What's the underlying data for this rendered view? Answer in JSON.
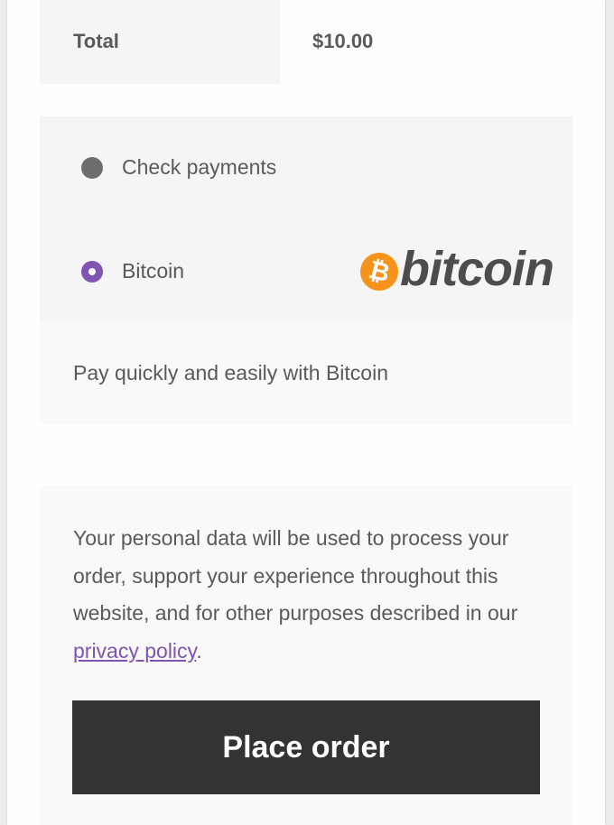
{
  "order_summary": {
    "total_label": "Total",
    "total_value": "$10.00"
  },
  "payment": {
    "methods": [
      {
        "label": "Check payments",
        "selected": false
      },
      {
        "label": "Bitcoin",
        "selected": true
      }
    ],
    "bitcoin_logo": {
      "symbol": "₿",
      "wordmark": "bitcoin"
    },
    "selected_description": "Pay quickly and easily with Bitcoin"
  },
  "privacy": {
    "text": "Your personal data will be used to process your order, support your experience throughout this website, and for other purposes described in our ",
    "link_label": "privacy policy",
    "trailing": "."
  },
  "actions": {
    "place_order_label": "Place order"
  },
  "colors": {
    "accent": "#7f54b3",
    "button_bg": "#333333",
    "bitcoin_orange": "#f7931a"
  }
}
